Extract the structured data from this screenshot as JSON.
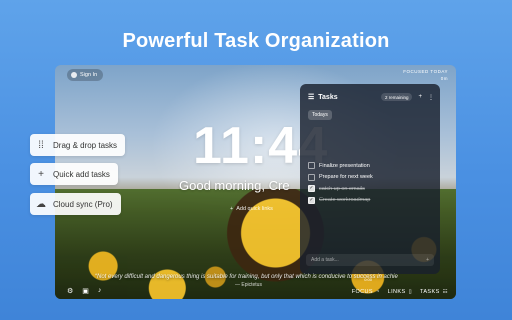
{
  "hero": {
    "title": "Powerful Task Organization"
  },
  "app": {
    "sign_in": "Sign In",
    "focused_label": "FOCUSED TODAY",
    "focused_value": "0m",
    "clock": "11:44",
    "greeting": "Good morning, Cre",
    "add_quick_links": "Add quick links",
    "quote": "“Not every difficult and dangerous thing is suitable for training, but only that which is conducive to success in achie",
    "author": "— Epictetus",
    "focus_label": "FOCUS",
    "focus_time": "0:00",
    "links_label": "LINKS",
    "tasks_label": "TASKS"
  },
  "tasks": {
    "title": "Tasks",
    "remaining": "2 remaining",
    "list_name": "Todays",
    "items": [
      {
        "text": "Finalize presentation",
        "done": false
      },
      {
        "text": "Prepare for next week",
        "done": false
      },
      {
        "text": "catch up on emails",
        "done": true
      },
      {
        "text": "Create workroadmap",
        "done": true
      }
    ],
    "add_placeholder": "Add a task..."
  },
  "features": [
    {
      "label": "Drag & drop tasks",
      "icon": "drag-handle-icon"
    },
    {
      "label": "Quick add tasks",
      "icon": "plus-icon"
    },
    {
      "label": "Cloud sync (Pro)",
      "icon": "cloud-icon"
    }
  ]
}
